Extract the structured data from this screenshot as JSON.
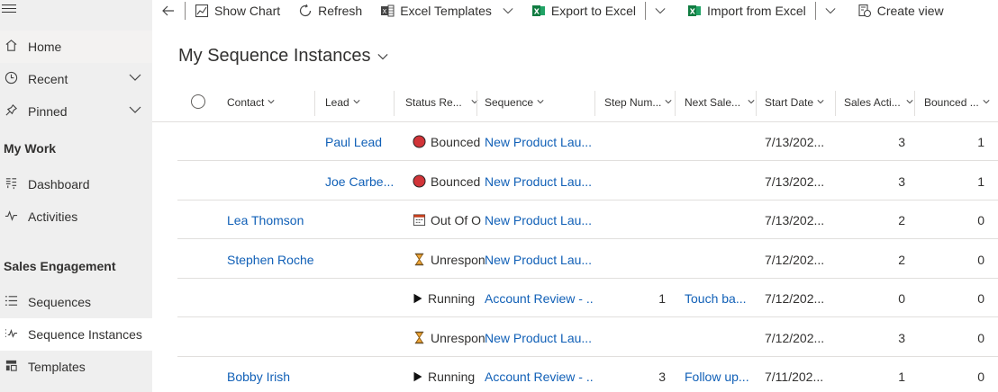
{
  "sidebar": {
    "items": [
      {
        "label": "Home",
        "icon": "home-icon"
      },
      {
        "label": "Recent",
        "icon": "clock-icon"
      },
      {
        "label": "Pinned",
        "icon": "pin-icon"
      }
    ],
    "sections": [
      {
        "title": "My Work",
        "items": [
          {
            "label": "Dashboard",
            "icon": "dashboard-icon"
          },
          {
            "label": "Activities",
            "icon": "activity-icon"
          }
        ]
      },
      {
        "title": "Sales Engagement",
        "items": [
          {
            "label": "Sequences",
            "icon": "list-icon"
          },
          {
            "label": "Sequence Instances",
            "icon": "sequence-icon"
          },
          {
            "label": "Templates",
            "icon": "template-icon"
          }
        ]
      }
    ]
  },
  "toolbar": {
    "show_chart": "Show Chart",
    "refresh": "Refresh",
    "excel_templates": "Excel Templates",
    "export_to_excel": "Export to Excel",
    "import_from_excel": "Import from Excel",
    "create_view": "Create view"
  },
  "view": {
    "title": "My Sequence Instances"
  },
  "grid": {
    "columns": [
      "Contact",
      "Lead",
      "Status Re...",
      "Sequence",
      "Step Num...",
      "Next Sale...",
      "Start Date",
      "Sales Acti...",
      "Bounced ..."
    ],
    "rows": [
      {
        "contact": "",
        "lead": "Paul Lead",
        "status": "Bounced",
        "status_icon": "bounced",
        "sequence": "New Product Lau...",
        "step": "",
        "next": "",
        "start": "7/13/202...",
        "sales": "3",
        "bounced": "1"
      },
      {
        "contact": "",
        "lead": "Joe Carbe...",
        "status": "Bounced",
        "status_icon": "bounced",
        "sequence": "New Product Lau...",
        "step": "",
        "next": "",
        "start": "7/13/202...",
        "sales": "3",
        "bounced": "1"
      },
      {
        "contact": "Lea Thomson",
        "lead": "",
        "status": "Out Of O",
        "status_icon": "calendar",
        "sequence": "New Product Lau...",
        "step": "",
        "next": "",
        "start": "7/13/202...",
        "sales": "2",
        "bounced": "0"
      },
      {
        "contact": "Stephen Roche",
        "lead": "",
        "status": "Unrespon",
        "status_icon": "hourglass",
        "sequence": "New Product Lau...",
        "step": "",
        "next": "",
        "start": "7/12/202...",
        "sales": "2",
        "bounced": "0"
      },
      {
        "contact": "",
        "lead": "",
        "status": "Running",
        "status_icon": "play",
        "sequence": "Account Review - ...",
        "step": "1",
        "next": "Touch ba...",
        "start": "7/12/202...",
        "sales": "0",
        "bounced": "0"
      },
      {
        "contact": "",
        "lead": "",
        "status": "Unrespon",
        "status_icon": "hourglass",
        "sequence": "New Product Lau...",
        "step": "",
        "next": "",
        "start": "7/12/202...",
        "sales": "3",
        "bounced": "0"
      },
      {
        "contact": "Bobby Irish",
        "lead": "",
        "status": "Running",
        "status_icon": "play",
        "sequence": "Account Review - ...",
        "step": "3",
        "next": "Follow up...",
        "start": "7/11/202...",
        "sales": "1",
        "bounced": "0"
      }
    ]
  },
  "colors": {
    "link": "#1160b7",
    "bounced": "#d13438",
    "excel": "#107c41"
  }
}
